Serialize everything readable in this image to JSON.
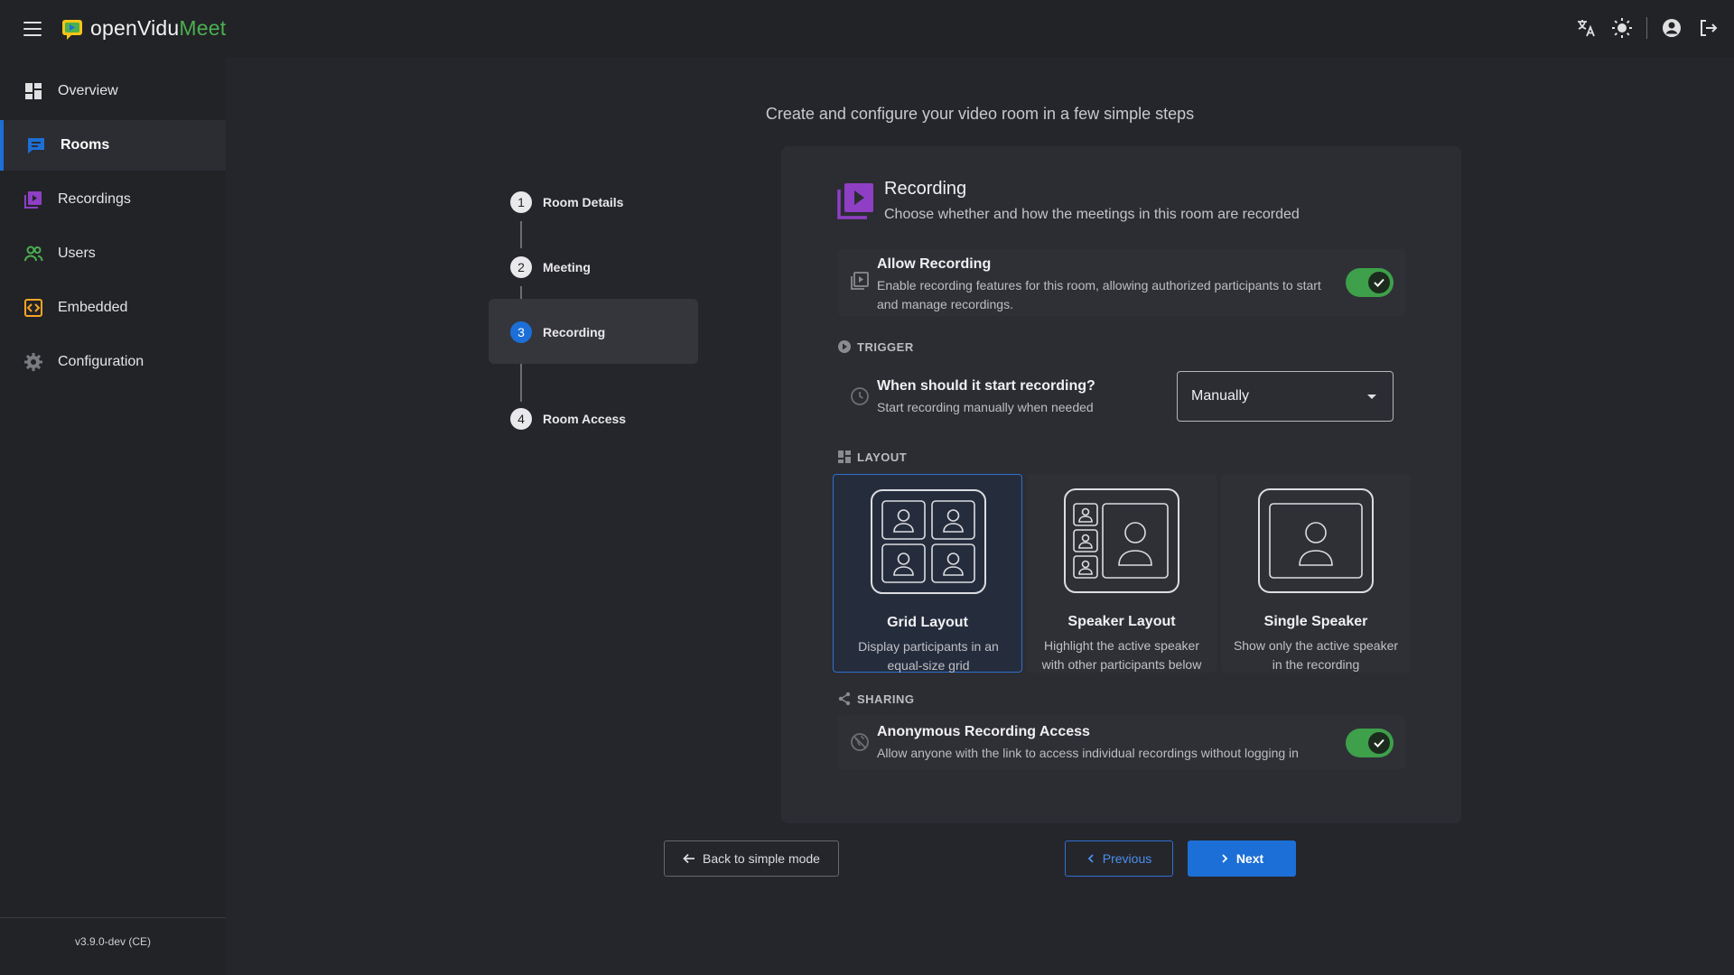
{
  "app": {
    "logo_part1": "openVidu",
    "logo_part2": "Meet",
    "version": "v3.9.0-dev (CE)"
  },
  "topbar_icons": [
    "translate-icon",
    "theme-light-icon",
    "account-circle-icon",
    "logout-icon"
  ],
  "sidebar": {
    "items": [
      {
        "label": "Overview",
        "icon": "dashboard-icon",
        "color": "#e0e0e0"
      },
      {
        "label": "Rooms",
        "icon": "chat-bubble-icon",
        "color": "#1c6fd6",
        "active": true
      },
      {
        "label": "Recordings",
        "icon": "video-library-icon",
        "color": "#8e3fc4"
      },
      {
        "label": "Users",
        "icon": "group-icon",
        "color": "#4caf50"
      },
      {
        "label": "Embedded",
        "icon": "code-box-icon",
        "color": "#f5a623"
      },
      {
        "label": "Configuration",
        "icon": "gear-icon",
        "color": "#7a7b80"
      }
    ]
  },
  "main": {
    "subtitle": "Create and configure your video room in a few simple steps"
  },
  "stepper": {
    "steps": [
      {
        "num": "1",
        "label": "Room Details"
      },
      {
        "num": "2",
        "label": "Meeting"
      },
      {
        "num": "3",
        "label": "Recording",
        "active": true
      },
      {
        "num": "4",
        "label": "Room Access"
      }
    ]
  },
  "card": {
    "title": "Recording",
    "description": "Choose whether and how the meetings in this room are recorded",
    "allow_recording": {
      "title": "Allow Recording",
      "description_line1": "Enable recording features for this room, allowing authorized participants to start",
      "description_line2": "and manage recordings.",
      "enabled": true
    },
    "trigger": {
      "section_label": "TRIGGER",
      "question": "When should it start recording?",
      "hint": "Start recording manually when needed",
      "selected": "Manually"
    },
    "layout": {
      "section_label": "LAYOUT",
      "options": [
        {
          "name": "Grid Layout",
          "desc_line1": "Display participants in an",
          "desc_line2": "equal-size grid",
          "selected": true
        },
        {
          "name": "Speaker Layout",
          "desc_line1": "Highlight the active speaker",
          "desc_line2": "with other participants below"
        },
        {
          "name": "Single Speaker",
          "desc_line1": "Show only the active speaker",
          "desc_line2": "in the recording"
        }
      ]
    },
    "sharing": {
      "section_label": "SHARING",
      "title": "Anonymous Recording Access",
      "description": "Allow anyone with the link to access individual recordings without logging in",
      "enabled": true
    }
  },
  "actions": {
    "back_label": "Back to simple mode",
    "previous_label": "Previous",
    "next_label": "Next"
  },
  "colors": {
    "accent_blue": "#1c6fd6",
    "toggle_green": "#3ea04a",
    "recording_purple": "#8e3fc4"
  }
}
